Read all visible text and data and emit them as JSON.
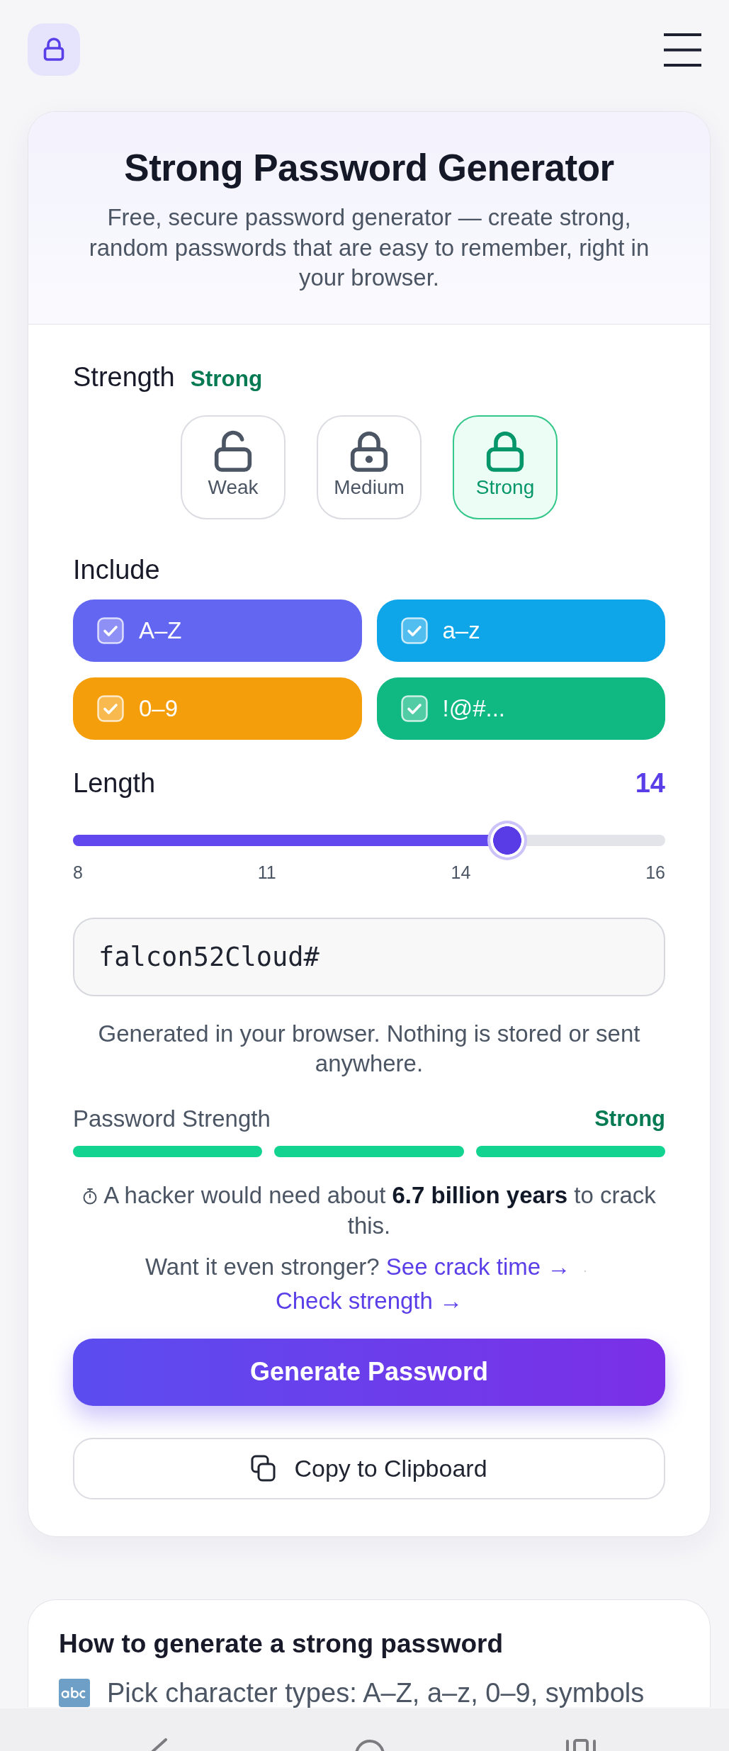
{
  "intro": {
    "title": "Strong Password Generator",
    "subtitle": "Free, secure password generator — create strong, random passwords that are easy to remember, right in your browser."
  },
  "strength": {
    "label": "Strength",
    "value": "Strong",
    "options": [
      {
        "label": "Weak",
        "kind": "open",
        "selected": false
      },
      {
        "label": "Medium",
        "kind": "keyhole",
        "selected": false
      },
      {
        "label": "Strong",
        "kind": "closed",
        "selected": true
      }
    ]
  },
  "include": {
    "label": "Include",
    "options": [
      {
        "label": "A–Z",
        "checked": true,
        "color": "#6366f1"
      },
      {
        "label": "a–z",
        "checked": true,
        "color": "#0ea5e9"
      },
      {
        "label": "0–9",
        "checked": true,
        "color": "#f59e0b"
      },
      {
        "label": "!@#...",
        "checked": true,
        "color": "#10b981"
      }
    ]
  },
  "length": {
    "label": "Length",
    "value": "14",
    "level": 0.75,
    "ticks": [
      "8",
      "11",
      "14",
      "16"
    ]
  },
  "password": {
    "value": "falcon52Cloud#"
  },
  "note": "Generated in your browser. Nothing is stored or sent anywhere.",
  "meter": {
    "label": "Password Strength",
    "value": "Strong",
    "segments": [
      {
        "on": true
      },
      {
        "on": true
      },
      {
        "on": true
      }
    ]
  },
  "crack_time": "A hacker would need about **6.7 billion years** to crack this.",
  "upsell": {
    "text": "Want it even stronger?",
    "links": [
      "See crack time →",
      "Check strength →"
    ],
    "separator": "·"
  },
  "buttons": {
    "generate": "Generate Password",
    "copy": "Copy to Clipboard"
  },
  "guide": {
    "title": "How to generate a strong password",
    "steps": [
      "Pick character types: A–Z, a–z, 0–9, symbols"
    ]
  }
}
